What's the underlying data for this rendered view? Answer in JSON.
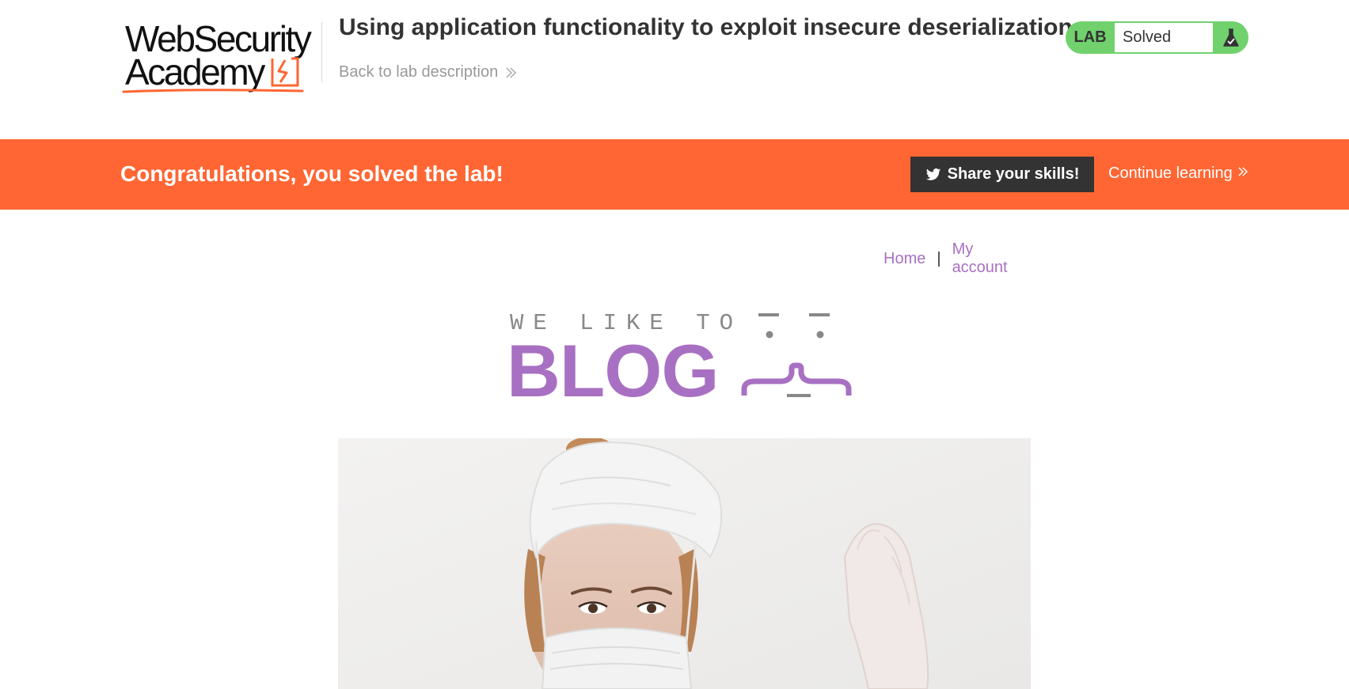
{
  "header": {
    "logo_text_line1": "WebSecurity",
    "logo_text_line2": "Academy",
    "lab_title": "Using application functionality to exploit insecure deserialization",
    "back_link_label": "Back to lab description",
    "lab_badge_label": "LAB",
    "lab_status": "Solved",
    "flask_icon": "flask-icon"
  },
  "banner": {
    "message": "Congratulations, you solved the lab!",
    "share_label": "Share your skills!",
    "share_icon": "twitter-icon",
    "continue_label": "Continue learning"
  },
  "nav": {
    "home_label": "Home",
    "separator": "|",
    "account_label": "My account"
  },
  "blog_logo": {
    "tagline": "WE LIKE TO",
    "word": "BLOG"
  },
  "colors": {
    "accent_orange": "#ff6633",
    "lab_green": "#70d16d",
    "link_purple": "#a870c2",
    "dark_button": "#333333"
  }
}
